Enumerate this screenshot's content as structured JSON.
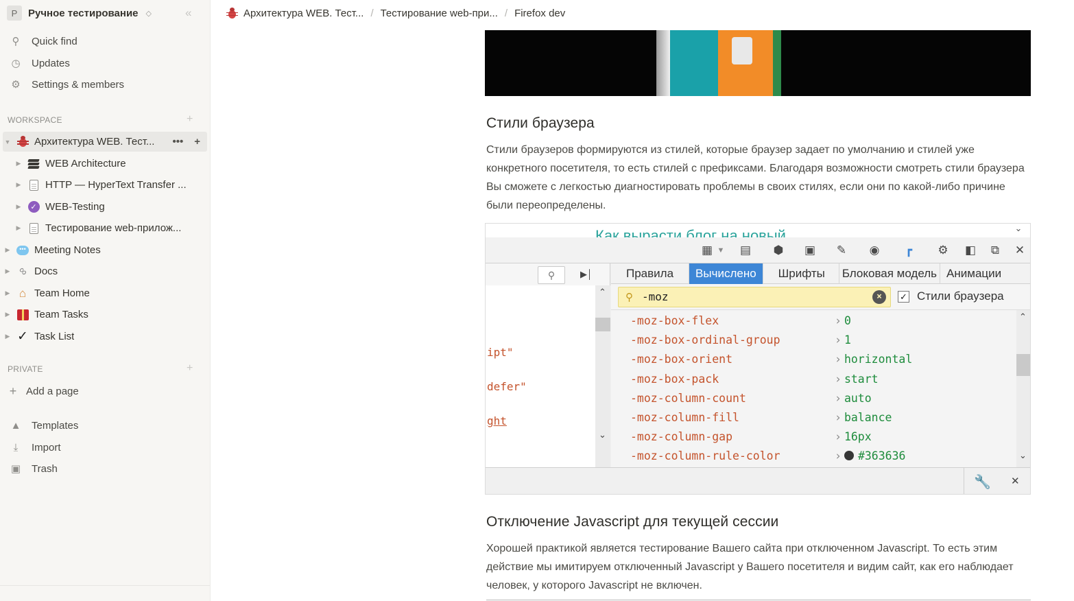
{
  "workspace": {
    "avatar_letter": "P",
    "name": "Ручное тестирование",
    "chevron": "◇"
  },
  "sidebar": {
    "collapse_icon": "«",
    "nav": [
      {
        "label": "Quick find",
        "icon": "search-icon"
      },
      {
        "label": "Updates",
        "icon": "clock-icon"
      },
      {
        "label": "Settings & members",
        "icon": "gear-icon"
      }
    ],
    "workspace_section": "WORKSPACE",
    "tree": [
      {
        "label": "Архитектура WEB. Тест...",
        "icon": "bug-icon",
        "expanded": true,
        "active": true
      },
      {
        "label": "WEB Architecture",
        "icon": "layers-icon",
        "child": true
      },
      {
        "label": "HTTP — HyperText Transfer ...",
        "icon": "document-icon",
        "child": true
      },
      {
        "label": "WEB-Testing",
        "icon": "purple-check-icon",
        "child": true
      },
      {
        "label": "Тестирование web-прилож...",
        "icon": "document-icon",
        "child": true
      },
      {
        "label": "Meeting Notes",
        "icon": "speech-bubble-icon"
      },
      {
        "label": "Docs",
        "icon": "paperclip-icon"
      },
      {
        "label": "Team Home",
        "icon": "house-icon"
      },
      {
        "label": "Team Tasks",
        "icon": "gift-icon"
      },
      {
        "label": "Task List",
        "icon": "checkmark-icon"
      }
    ],
    "private_section": "PRIVATE",
    "add_page": "Add a page",
    "bottom": [
      {
        "label": "Templates",
        "icon": "shapes-icon"
      },
      {
        "label": "Import",
        "icon": "download-icon"
      },
      {
        "label": "Trash",
        "icon": "trash-icon"
      }
    ]
  },
  "breadcrumbs": [
    "Архитектура WEB. Тест...",
    "Тестирование web-при...",
    "Firefox dev"
  ],
  "content": {
    "heading1": "Стили браузера",
    "para1": "Стили браузеров формируются из стилей, которые браузер задает по умолчанию и стилей уже конкретного посетителя, то есть стилей с префиксами. Благодаря возможности смотреть стили браузера Вы сможете с легкостью диагностировать проблемы в своих стилях, если они по какой-либо причине были переопределены.",
    "heading2": "Отключение Javascript для текущей сессии",
    "para2": "Хорошей практикой является тестирование Вашего сайта при отключенном Javascript. То есть этим действие мы имитируем отключенный Javascript у Вашего посетителя и видим сайт, как его наблюдает человек, у которого Javascript не включен."
  },
  "devtools": {
    "page_text": "Как вырасти блог на новый",
    "tabs": [
      "Правила",
      "Вычислено",
      "Шрифты",
      "Блоковая модель",
      "Анимации"
    ],
    "selected_tab": "Вычислено",
    "filter_value": "-moz",
    "browser_styles_label": "Стили браузера",
    "browser_styles_checked": "✓",
    "left_code": [
      "ipt\"",
      "defer\"",
      "ght"
    ],
    "properties": [
      {
        "name": "-moz-box-flex",
        "value": "0"
      },
      {
        "name": "-moz-box-ordinal-group",
        "value": "1"
      },
      {
        "name": "-moz-box-orient",
        "value": "horizontal"
      },
      {
        "name": "-moz-box-pack",
        "value": "start"
      },
      {
        "name": "-moz-column-count",
        "value": "auto"
      },
      {
        "name": "-moz-column-fill",
        "value": "balance"
      },
      {
        "name": "-moz-column-gap",
        "value": "16px"
      },
      {
        "name": "-moz-column-rule-color",
        "value": "#363636"
      }
    ]
  }
}
